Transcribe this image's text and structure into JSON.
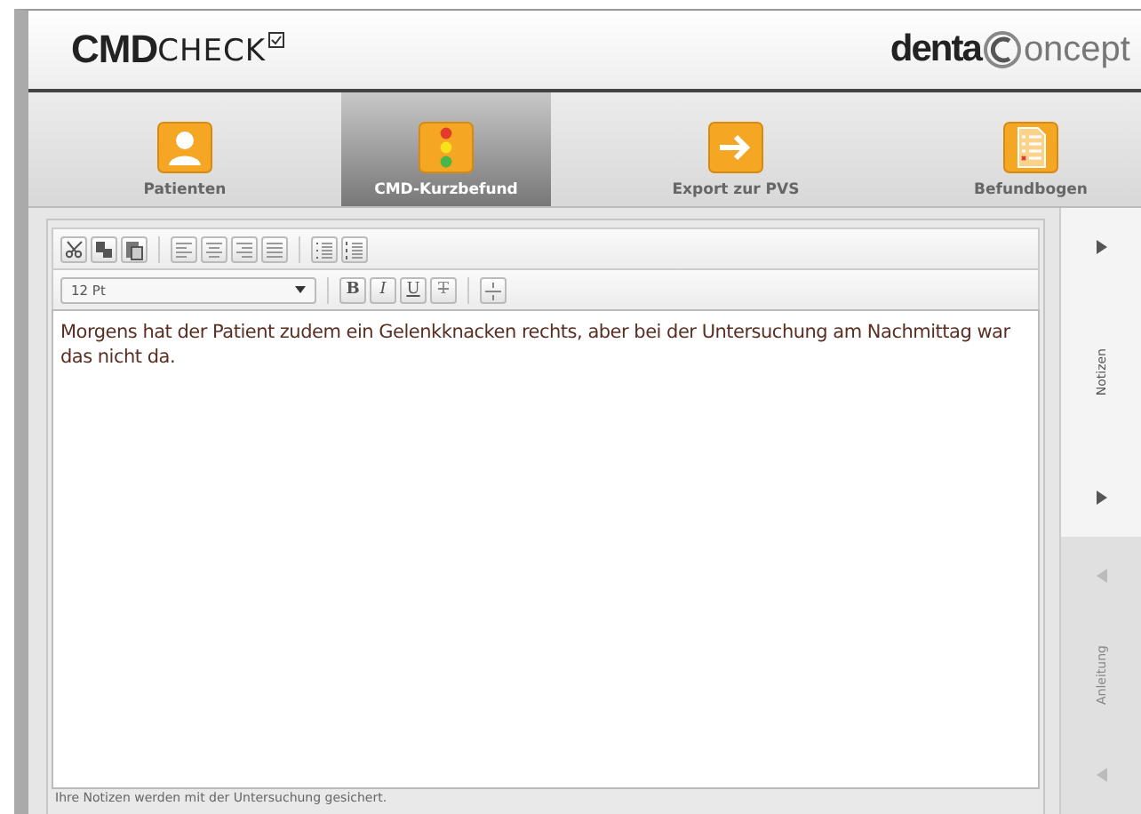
{
  "header": {
    "logo": {
      "brand": "CMD",
      "product": "CHECK"
    },
    "partner_logo": {
      "first": "denta",
      "second": "oncept"
    }
  },
  "tabs": [
    {
      "label": "Patienten",
      "kind": "person",
      "selected": false
    },
    {
      "label": "CMD-Kurzbefund",
      "kind": "status",
      "selected": true
    },
    {
      "label": "Export zur PVS",
      "kind": "export",
      "selected": false
    },
    {
      "label": "Befundbogen",
      "kind": "form",
      "selected": false
    }
  ],
  "toolbar": {
    "rows": [
      [
        [
          {
            "kind": "cut"
          },
          {
            "kind": "copy"
          },
          {
            "kind": "paste"
          }
        ],
        [
          {
            "kind": "align-left"
          },
          {
            "kind": "align-center"
          },
          {
            "kind": "align-right"
          },
          {
            "kind": "justify"
          }
        ],
        [
          {
            "kind": "bullets"
          },
          {
            "kind": "numbers"
          }
        ]
      ],
      [
        [
          {
            "kind": "bold",
            "label": "B"
          },
          {
            "kind": "italic",
            "label": "I"
          },
          {
            "kind": "underline",
            "label": "U"
          },
          {
            "kind": "strike",
            "label": "T"
          }
        ],
        [
          {
            "kind": "rule"
          }
        ]
      ]
    ],
    "font_size": "12 Pt"
  },
  "editor": {
    "text": "Morgens hat der Patient zudem ein Gelenkknacken rechts, aber bei der Untersuchung am Nachmittag war das nicht da."
  },
  "side_tabs": [
    {
      "label": "Notizen",
      "selected": true
    },
    {
      "label": "Anleitung",
      "selected": false
    }
  ],
  "status_bar": "Ihre Notizen werden mit der Untersuchung gesichert."
}
